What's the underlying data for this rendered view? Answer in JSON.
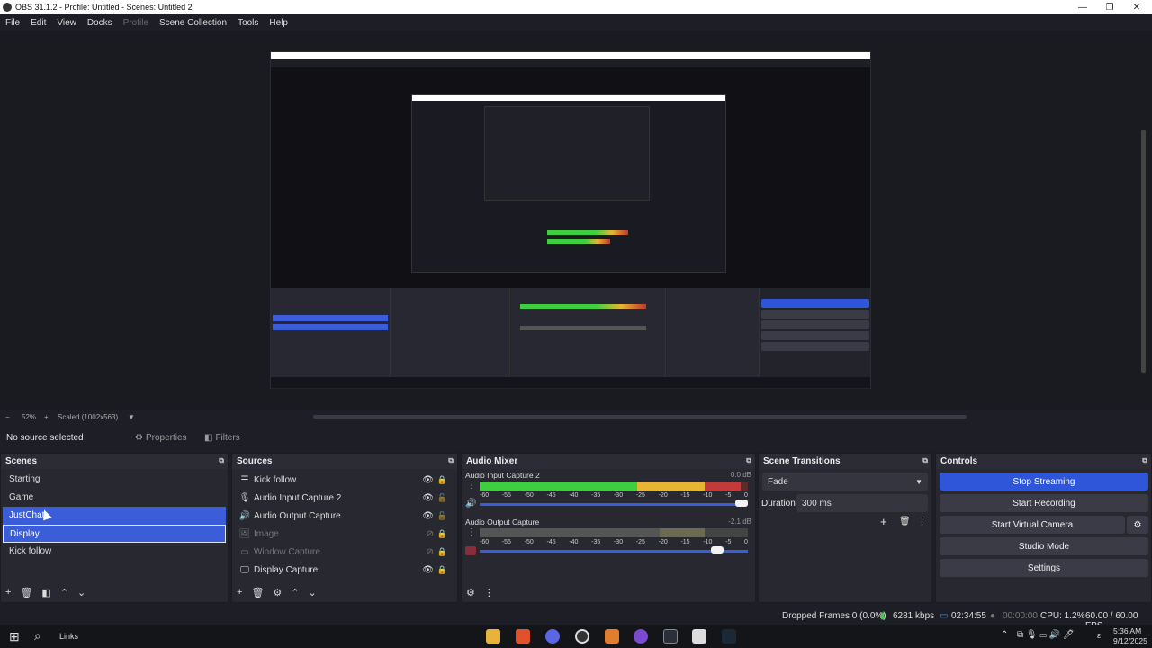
{
  "window": {
    "title": "OBS 31.1.2 - Profile: Untitled - Scenes: Untitled 2",
    "minimize": "—",
    "maximize": "❐",
    "close": "✕"
  },
  "menu": [
    "File",
    "Edit",
    "View",
    "Docks",
    "Profile",
    "Scene Collection",
    "Tools",
    "Help"
  ],
  "preview_bar": {
    "zoom_minus": "−",
    "zoom": "52%",
    "zoom_plus": "+",
    "scale": "Scaled (1002x563)",
    "dropdown": "▼"
  },
  "source_toolbar": {
    "status": "No source selected",
    "properties": "Properties",
    "filters": "Filters"
  },
  "scenes": {
    "title": "Scenes",
    "items": [
      "Starting",
      "Game",
      "JustChat",
      "Display",
      "Kick follow"
    ]
  },
  "sources": {
    "title": "Sources",
    "items": [
      {
        "icon": "list-icon",
        "glyph": "☰",
        "label": "Kick follow"
      },
      {
        "icon": "microphone-icon",
        "glyph": "🎙",
        "label": "Audio Input Capture 2"
      },
      {
        "icon": "speaker-icon",
        "glyph": "🔊",
        "label": "Audio Output Capture"
      },
      {
        "icon": "image-icon",
        "glyph": "🖼",
        "label": "Image"
      },
      {
        "icon": "window-icon",
        "glyph": "▭",
        "label": "Window Capture"
      },
      {
        "icon": "monitor-icon",
        "glyph": "🖵",
        "label": "Display Capture"
      }
    ]
  },
  "audio_mixer": {
    "title": "Audio Mixer",
    "channels": [
      {
        "name": "Audio Input Capture 2",
        "db": "0.0 dB",
        "level_fraction": 0.97,
        "volume_fraction": 0.98
      },
      {
        "name": "Audio Output Capture",
        "db": "-2.1 dB",
        "level_fraction": 0.0,
        "volume_fraction": 0.87
      }
    ],
    "scale": [
      "-60",
      "-55",
      "-50",
      "-45",
      "-40",
      "-35",
      "-30",
      "-25",
      "-20",
      "-15",
      "-10",
      "-5",
      "0"
    ]
  },
  "transitions": {
    "title": "Scene Transitions",
    "selected": "Fade",
    "duration_label": "Duration",
    "duration": "300 ms"
  },
  "controls": {
    "title": "Controls",
    "buttons": [
      "Stop Streaming",
      "Start Recording",
      "Start Virtual Camera",
      "Studio Mode",
      "Settings"
    ]
  },
  "status": {
    "dropped": "Dropped Frames 0 (0.0%)",
    "bitrate": "6281 kbps",
    "stream_time": "02:34:55",
    "record_time": "00:00:00",
    "cpu": "CPU: 1.2%",
    "fps": "60.00 / 60.00 FPS"
  },
  "taskbar": {
    "search": "Links",
    "time": "5:36 AM",
    "date": "9/12/2025",
    "lang": "ε"
  },
  "colors": {
    "accent": "#3c5dd9",
    "stream_button": "#2f56d8",
    "meter_green": "#3fce3f",
    "meter_yellow": "#e5b533",
    "meter_red": "#c23b3b"
  }
}
